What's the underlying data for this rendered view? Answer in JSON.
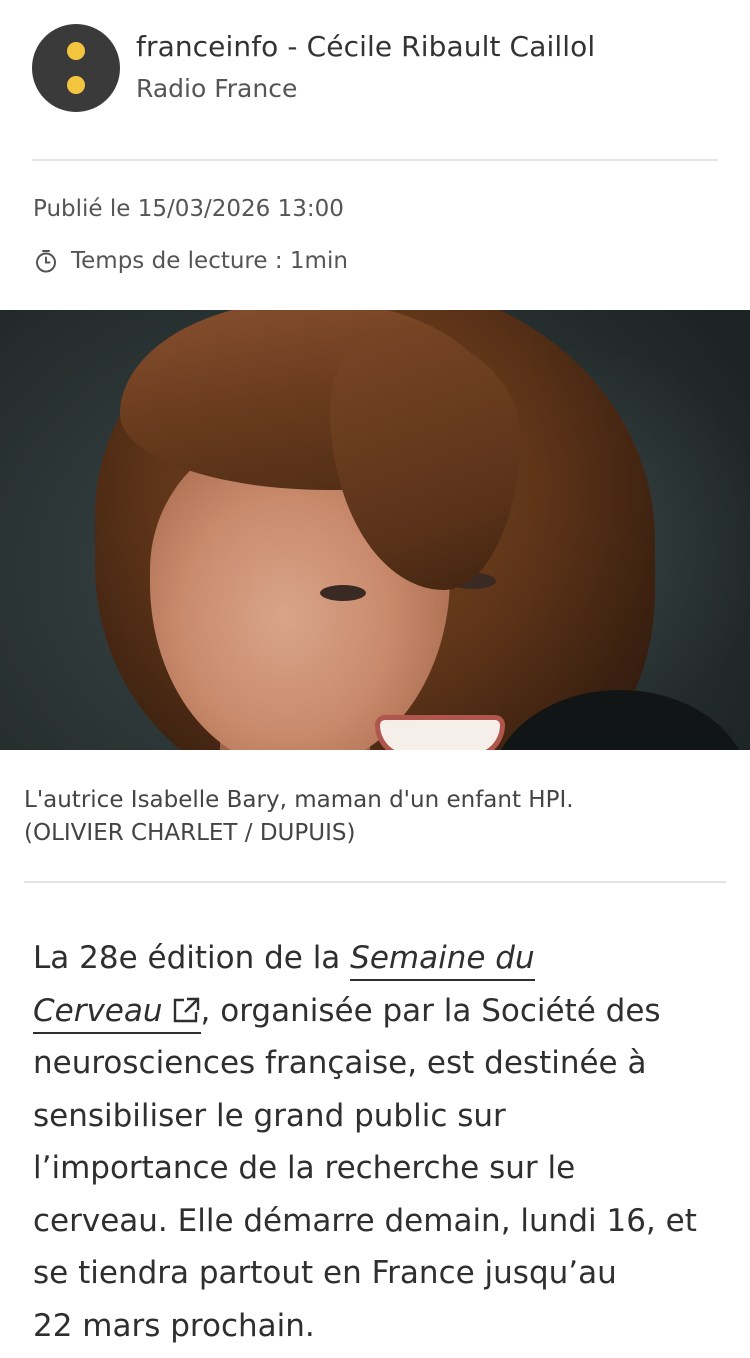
{
  "author": {
    "logo_icon": "franceinfo-logo-icon",
    "logo_colors": {
      "background": "#3a3a3a",
      "dots": "#f4c640"
    },
    "name": "franceinfo - Cécile Ribault Caillol",
    "organization": "Radio France"
  },
  "meta": {
    "published": "Publié le 15/03/2026 13:00",
    "reading_time_icon": "stopwatch-icon",
    "reading_time": "Temps de lecture : 1min"
  },
  "image": {
    "caption": "L'autrice Isabelle Bary, maman d'un enfant HPI.",
    "credit": "(OLIVIER CHARLET / DUPUIS)"
  },
  "article": {
    "before_link": "La 28e édition de la ",
    "link_text_1": "Semaine du",
    "link_text_2": "Cerveau",
    "external_link_icon": "external-link-icon",
    "after_link": ", organisée par la Société des",
    "lines": [
      "neurosciences française, est destinée à",
      "sensibiliser le grand public sur",
      "l’importance de la recherche sur le",
      "cerveau. Elle démarre demain, lundi 16, et",
      "se tiendra partout en France jusqu’au",
      "22 mars prochain."
    ]
  }
}
